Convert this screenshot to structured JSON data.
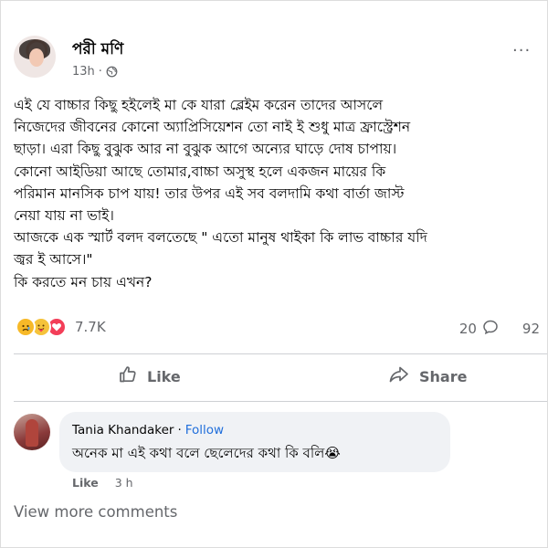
{
  "post": {
    "author": "পরী মণি",
    "time": "13h",
    "meta_separator": "·",
    "globe_icon": "globe-icon",
    "more_icon": "more-options-icon",
    "body_lines": [
      "এই যে বাচ্চার কিছু হইলেই মা কে যারা ব্লেইম করেন তাদের আসলে",
      "নিজেদের জীবনের কোনো অ্যাপ্রিসিয়েশন তো নাই ই শুধু মাত্র ফ্রাস্ট্রেশন",
      "ছাড়া। এরা কিছু বুঝুক আর না বুঝুক আগে অন্যের ঘাড়ে দোষ চাপায়।",
      "কোনো আইডিয়া আছে তোমার,বাচ্চা অসুস্থ হলে একজন মায়ের কি",
      "পরিমান মানসিক চাপ যায়! তার উপর এই সব বলদামি কথা বার্তা জাস্ট",
      "নেয়া যায় না ভাই।",
      "আজকে এক স্মার্ট বলদ বলতেছে \" এতো মানুষ থাইকা কি লাভ বাচ্চার যদি",
      "জ্বর ই আসে।\"",
      "কি করতে মন চায় এখন?"
    ]
  },
  "reactions": {
    "icons": [
      "sad-reaction-icon",
      "care-reaction-icon",
      "love-reaction-icon"
    ],
    "count": "7.7K",
    "comments_count": "20",
    "shares_count": "92"
  },
  "actions": {
    "like_label": "Like",
    "share_label": "Share"
  },
  "comment": {
    "author": "Tania Khandaker",
    "separator": "·",
    "follow_label": "Follow",
    "text": "অনেক মা এই কথা বলে ছেলেদের কথা কি বলি😭",
    "like_label": "Like",
    "time": "3 h"
  },
  "view_more_label": "View more comments",
  "colors": {
    "text": "#050505",
    "secondary": "#65676b",
    "follow": "#216fdb",
    "bubble": "#f0f2f5",
    "love": "#f33e58",
    "sad": "#f7b928"
  }
}
